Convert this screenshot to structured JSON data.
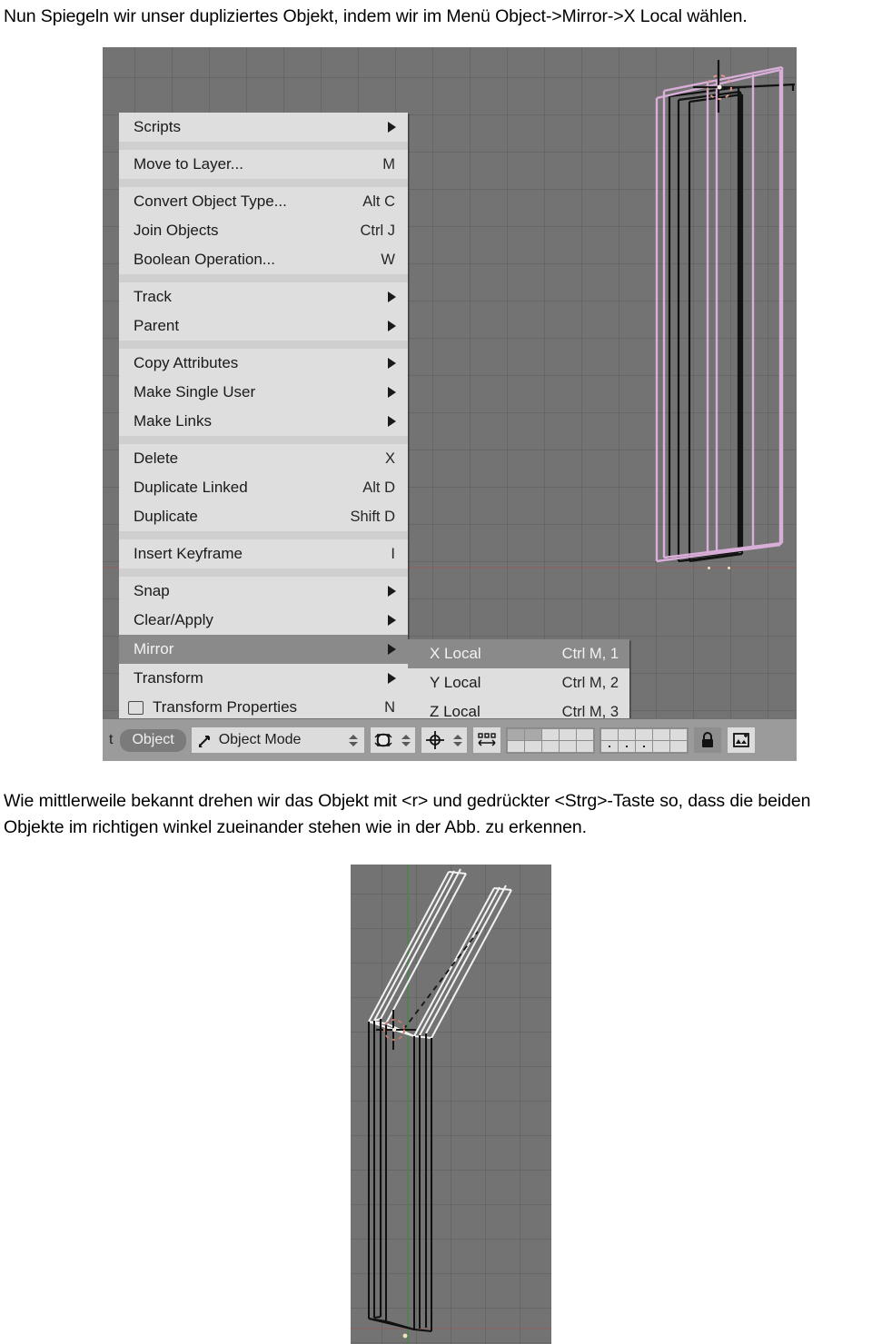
{
  "document": {
    "intro_paragraph": "Nun Spiegeln wir unser dupliziertes Objekt, indem wir im Menü Object->Mirror->X Local wählen.",
    "middle_paragraph": "Wie mittlerweile bekannt drehen wir das Objekt mit <r> und gedrückter <Strg>-Taste so, dass die beiden Objekte im richtigen winkel zueinander stehen wie in der Abb. zu erkennen."
  },
  "object_menu": {
    "items": [
      {
        "label": "Scripts",
        "shortcut": "",
        "submenu": true
      },
      {
        "separator": true
      },
      {
        "label": "Move to Layer...",
        "shortcut": "M",
        "submenu": false
      },
      {
        "separator": true
      },
      {
        "label": "Convert Object Type...",
        "shortcut": "Alt C",
        "submenu": false
      },
      {
        "label": "Join Objects",
        "shortcut": "Ctrl J",
        "submenu": false
      },
      {
        "label": "Boolean Operation...",
        "shortcut": "W",
        "submenu": false
      },
      {
        "separator": true
      },
      {
        "label": "Track",
        "shortcut": "",
        "submenu": true
      },
      {
        "label": "Parent",
        "shortcut": "",
        "submenu": true
      },
      {
        "separator": true
      },
      {
        "label": "Copy Attributes",
        "shortcut": "",
        "submenu": true
      },
      {
        "label": "Make Single User",
        "shortcut": "",
        "submenu": true
      },
      {
        "label": "Make Links",
        "shortcut": "",
        "submenu": true
      },
      {
        "separator": true
      },
      {
        "label": "Delete",
        "shortcut": "X",
        "submenu": false
      },
      {
        "label": "Duplicate Linked",
        "shortcut": "Alt D",
        "submenu": false
      },
      {
        "label": "Duplicate",
        "shortcut": "Shift D",
        "submenu": false
      },
      {
        "separator": true
      },
      {
        "label": "Insert Keyframe",
        "shortcut": "I",
        "submenu": false
      },
      {
        "separator": true
      },
      {
        "label": "Snap",
        "shortcut": "",
        "submenu": true
      },
      {
        "label": "Clear/Apply",
        "shortcut": "",
        "submenu": true
      },
      {
        "label": "Mirror",
        "shortcut": "",
        "submenu": true,
        "highlighted": true
      },
      {
        "label": "Transform",
        "shortcut": "",
        "submenu": true
      },
      {
        "label": "Transform Properties",
        "shortcut": "N",
        "submenu": false,
        "checkbox": true
      }
    ]
  },
  "mirror_submenu": {
    "items": [
      {
        "label": "X Local",
        "shortcut": "Ctrl M, 1",
        "highlighted": true
      },
      {
        "label": "Y Local",
        "shortcut": "Ctrl M, 2",
        "highlighted": false
      },
      {
        "label": "Z Local",
        "shortcut": "Ctrl M, 3",
        "highlighted": false
      }
    ]
  },
  "toolbar": {
    "menu_tail_text": "t",
    "object_menu_label": "Object",
    "mode_label": "Object Mode",
    "mode_icon": "object-mode-icon",
    "draw_type_icon": "draw-type-solid-icon",
    "pivot_icon": "pivot-center-icon",
    "transform_widget_icon": "transform-widget-icon",
    "lock_icon": "lock-icon",
    "render_icon": "render-window-icon"
  },
  "colors": {
    "viewport_bg": "#737373",
    "menu_bg": "#dedede",
    "menu_highlight": "#8a8a8a",
    "toolbar_bg": "#9b9b9b",
    "selected_wire": "#d9aed9",
    "active_wire": "#ffffff",
    "unselected_wire": "#111111",
    "axis_y": "#4f8250",
    "cursor_red": "#c76a5a"
  }
}
